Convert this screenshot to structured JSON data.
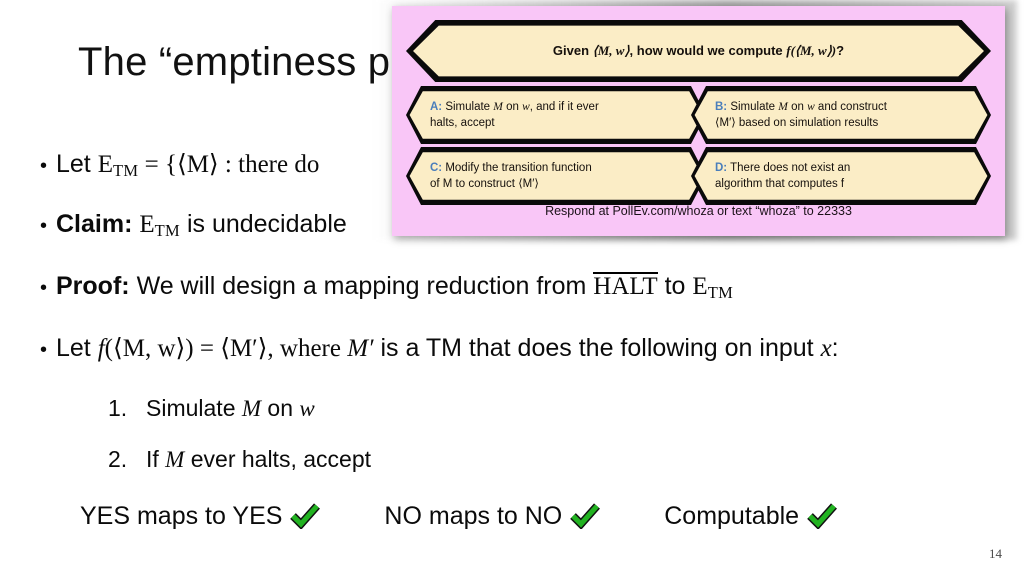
{
  "slide": {
    "title": "The “emptiness p",
    "page_number": "14",
    "bullets": {
      "b1_prefix": "Let ",
      "b1_symbol": "E",
      "b1_sub": "TM",
      "b1_rest": " = {⟨M⟩ : there do",
      "b2_label": "Claim:",
      "b2_symbol": "E",
      "b2_sub": "TM",
      "b2_rest": " is undecidable",
      "b3_label": "Proof:",
      "b3_text": "We will design a mapping reduction from",
      "b3_halt": "HALT",
      "b3_to": "to",
      "b3_symbol": "E",
      "b3_sub": "TM",
      "b4_prefix": "Let ",
      "b4_f": "f",
      "b4_arg": "(⟨M, w⟩) = ⟨M′⟩, where ",
      "b4_m": "M′",
      "b4_rest": " is a TM that does the following on input ",
      "b4_x": "x",
      "b4_colon": ":"
    },
    "numbered": [
      {
        "n": "1.",
        "text_a": "Simulate ",
        "ital_a": "M",
        "text_b": " on ",
        "ital_b": "w",
        "text_c": ""
      },
      {
        "n": "2.",
        "text_a": "If ",
        "ital_a": "M",
        "text_b": " ever halts, accept",
        "ital_b": "",
        "text_c": ""
      }
    ],
    "final_row": {
      "yes": "YES maps to YES",
      "no": "NO maps to NO",
      "computable": "Computable",
      "check_icon": "green-check-icon",
      "check_color": "#22b321"
    }
  },
  "poll": {
    "background_color": "#f9c6f7",
    "hex_fill_color": "#fbedc6",
    "hex_border_color": "#0a0a0a",
    "option_letter_color": "#4a7ebb",
    "question": {
      "pre": "Given ",
      "math1": "⟨M, w⟩",
      "mid": ", how would we compute ",
      "math2": "f(⟨M, w⟩)",
      "post": "?"
    },
    "options": [
      {
        "letter": "A:",
        "line1_a": " Simulate ",
        "ital1": "M",
        "line1_b": " on ",
        "ital2": "w",
        "line1_c": ", and if it ever",
        "line2": "halts, accept"
      },
      {
        "letter": "B:",
        "line1_a": " Simulate ",
        "ital1": "M",
        "line1_b": " on ",
        "ital2": "w",
        "line1_c": " and construct",
        "line2": "⟨M′⟩ based on simulation results"
      },
      {
        "letter": "C:",
        "line1_a": " Modify the transition function",
        "ital1": "",
        "line1_b": "",
        "ital2": "",
        "line1_c": "",
        "line2": "of M to construct ⟨M′⟩"
      },
      {
        "letter": "D:",
        "line1_a": " There does not exist an",
        "ital1": "",
        "line1_b": "",
        "ital2": "",
        "line1_c": "",
        "line2": "algorithm that computes f"
      }
    ],
    "footer": "Respond at PollEv.com/whoza or text “whoza” to 22333"
  }
}
